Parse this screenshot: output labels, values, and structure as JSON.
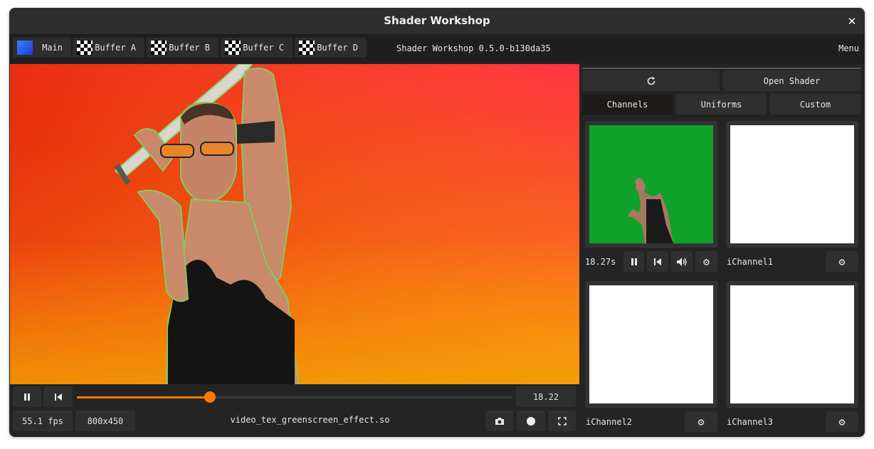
{
  "window": {
    "title": "Shader Workshop",
    "close_glyph": "✕"
  },
  "tabs": [
    {
      "label": "Main",
      "icon": "blue-swatch"
    },
    {
      "label": "Buffer A",
      "icon": "checker-swatch"
    },
    {
      "label": "Buffer B",
      "icon": "checker-swatch"
    },
    {
      "label": "Buffer C",
      "icon": "checker-swatch"
    },
    {
      "label": "Buffer D",
      "icon": "checker-swatch"
    }
  ],
  "version": "Shader Workshop 0.5.0-b130da35",
  "menu_label": "Menu",
  "playback": {
    "time": "18.22",
    "progress": 0.305,
    "fps": "55.1 fps",
    "resolution": "800x450",
    "filename": "video_tex_greenscreen_effect.so"
  },
  "side_panel": {
    "open_shader_label": "Open Shader",
    "tabs": [
      "Channels",
      "Uniforms",
      "Custom"
    ],
    "active_tab": "Channels",
    "channels": [
      {
        "label": "18.27s",
        "content": "greenscreen-video"
      },
      {
        "label": "iChannel1",
        "content": "blank"
      },
      {
        "label": "iChannel2",
        "content": "blank"
      },
      {
        "label": "iChannel3",
        "content": "blank"
      }
    ]
  },
  "colors": {
    "accent": "#ff7a00",
    "window_bg": "#242424",
    "greenscreen": "#0fa12a"
  }
}
